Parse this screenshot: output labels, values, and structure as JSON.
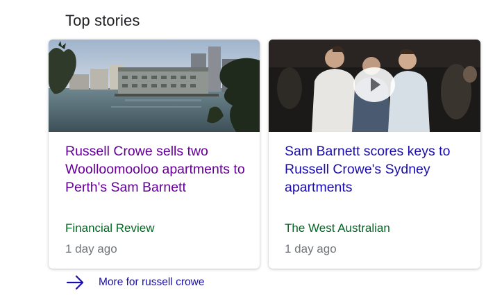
{
  "section": {
    "title": "Top stories"
  },
  "stories": [
    {
      "headline": "Russell Crowe sells two Woolloomooloo apartments to Perth's Sam Barnett",
      "source": "Financial Review",
      "time": "1 day ago",
      "visited": true
    },
    {
      "headline": "Sam Barnett scores keys to Russell Crowe's Sydney apartments",
      "source": "The West Australian",
      "time": "1 day ago",
      "has_video": true
    }
  ],
  "more": {
    "label": "More for russell crowe",
    "icon": "arrow-right-icon"
  },
  "colors": {
    "visited_link": "#660099",
    "link": "#1a0dab",
    "source": "#006621",
    "time": "#70757a"
  }
}
